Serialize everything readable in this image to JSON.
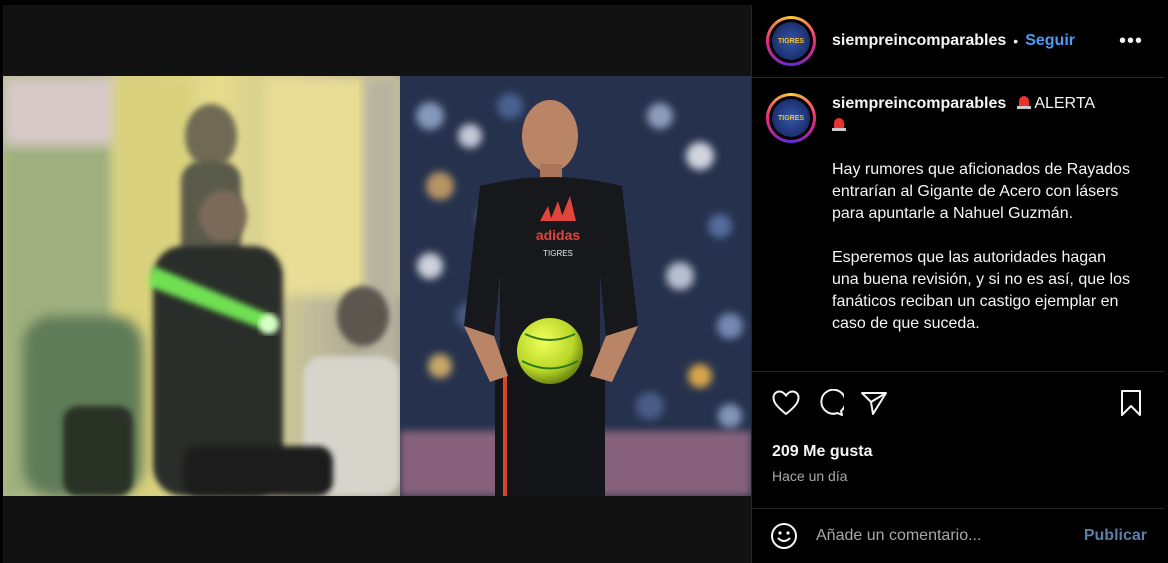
{
  "post": {
    "username": "siempreincomparables",
    "separator": "•",
    "follow_label": "Seguir",
    "more_label": "•••",
    "caption_username": "siempreincomparables",
    "caption_alert": "ALERTA",
    "caption_paragraph_1": "Hay rumores que aficionados de Rayados entrarían al Gigante de Acero con lásers para apuntarle a Nahuel Guzmán.",
    "caption_paragraph_2": "Esperemos que las autoridades hagan una buena revisión, y si no es así, que los fanáticos reciban un castigo ejemplar en caso de que suceda.",
    "likes": "209 Me gusta",
    "timestamp": "Hace un día",
    "avatar_text": "TIGRES"
  },
  "photo": {
    "shirt_brand": "adidas",
    "shirt_team": "TIGRES"
  },
  "comment": {
    "placeholder": "Añade un comentario...",
    "publish_label": "Publicar"
  },
  "icons": {
    "like": "heart-icon",
    "comment": "comment-icon",
    "share": "send-icon",
    "save": "bookmark-icon",
    "emoji": "emoji-icon",
    "siren": "siren-emoji"
  },
  "colors": {
    "background": "#000000",
    "follow": "#4a9df8",
    "publish": "#5b7fa8",
    "muted": "#a8a8a8"
  }
}
